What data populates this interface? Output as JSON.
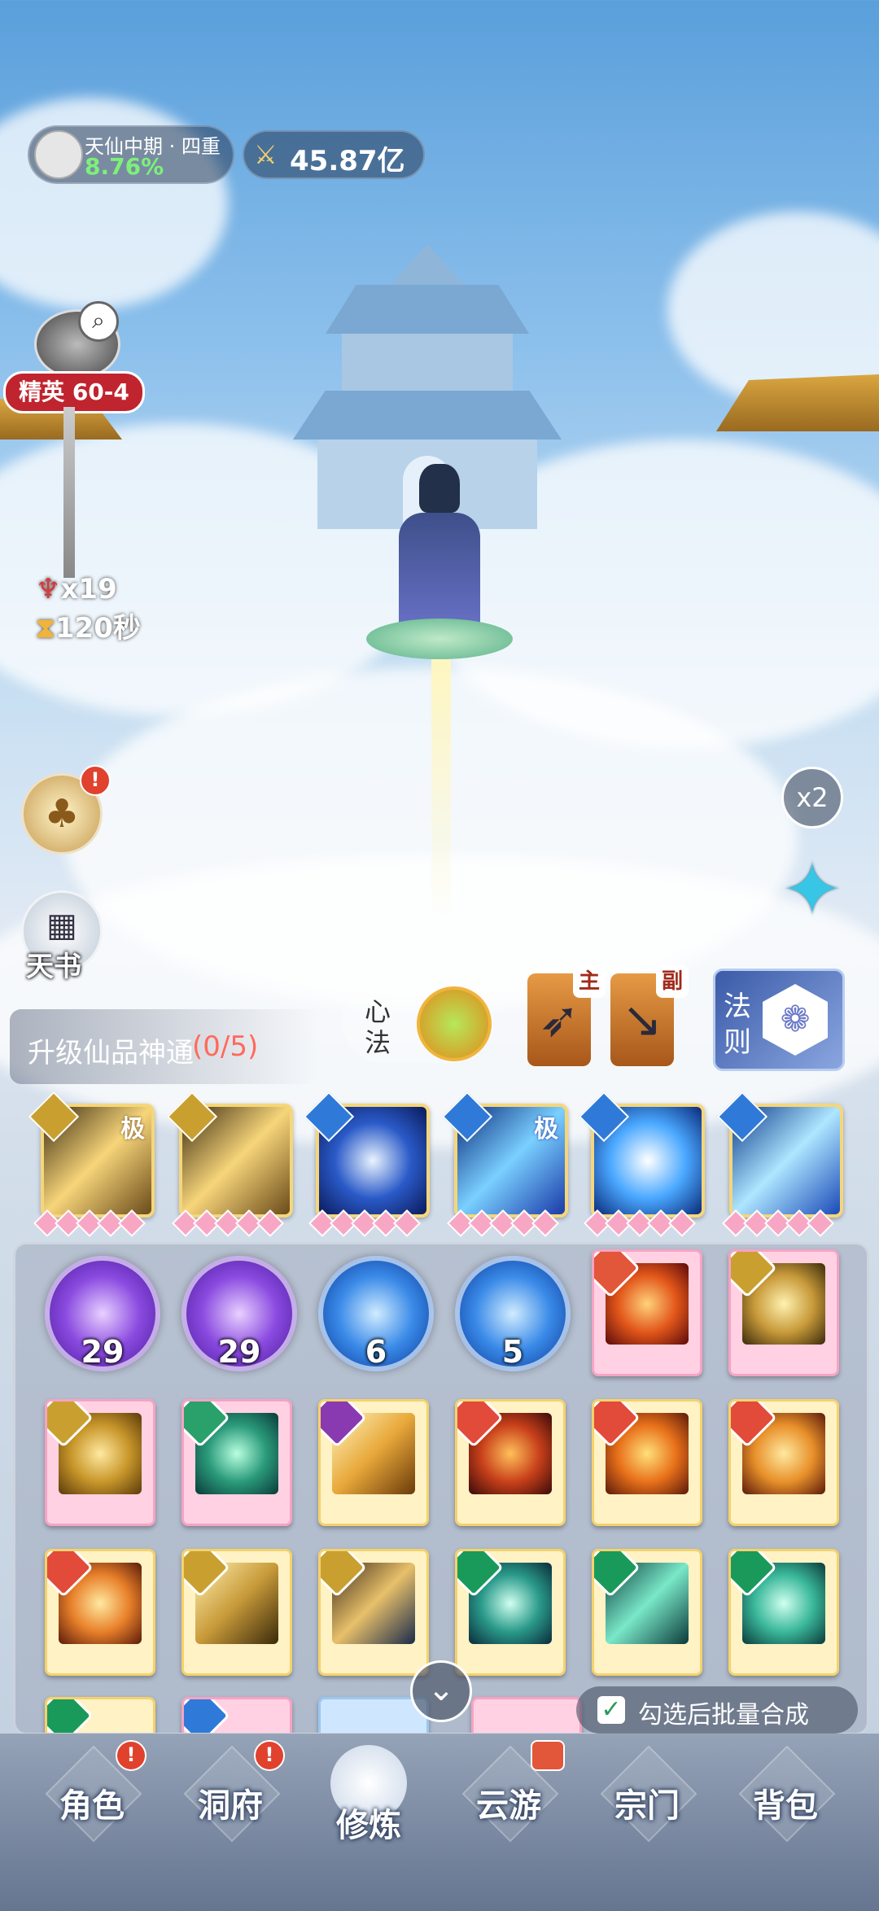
{
  "status": {
    "realm": "天仙中期 · 四重",
    "progress_text": "8.76%",
    "power": "45.87亿"
  },
  "stage": {
    "label": "精英 60-4",
    "enemies": "x19",
    "timer": "120秒"
  },
  "side_buttons": {
    "tianshu_label": "天书",
    "speed_label": "x2"
  },
  "xinfa": {
    "label_line1": "心",
    "label_line2": "法"
  },
  "weapons": {
    "main_tag": "主",
    "sub_tag": "副",
    "rules_line1": "法",
    "rules_line2": "则"
  },
  "upgrade_quest": {
    "text": "升级仙品神通",
    "progress": "(0/5)"
  },
  "equipped_skills": [
    {
      "tag": "极"
    },
    {
      "tag": ""
    },
    {
      "tag": ""
    },
    {
      "tag": "极"
    },
    {
      "tag": ""
    },
    {
      "tag": ""
    }
  ],
  "orbs": [
    {
      "count": "29"
    },
    {
      "count": "29"
    },
    {
      "count": "6"
    },
    {
      "count": "5"
    }
  ],
  "batch": {
    "label": "勾选后批量合成",
    "checked": true
  },
  "nav": {
    "role": "角色",
    "cave": "洞府",
    "train": "修炼",
    "travel": "云游",
    "sect": "宗门",
    "bag": "背包"
  },
  "colors": {
    "progress_green": "#7df07a",
    "quest_red": "#ff6a5a",
    "stage_red": "#c0242e",
    "gold_border": "#f4d26c",
    "pink_border": "#f6a3c3"
  }
}
